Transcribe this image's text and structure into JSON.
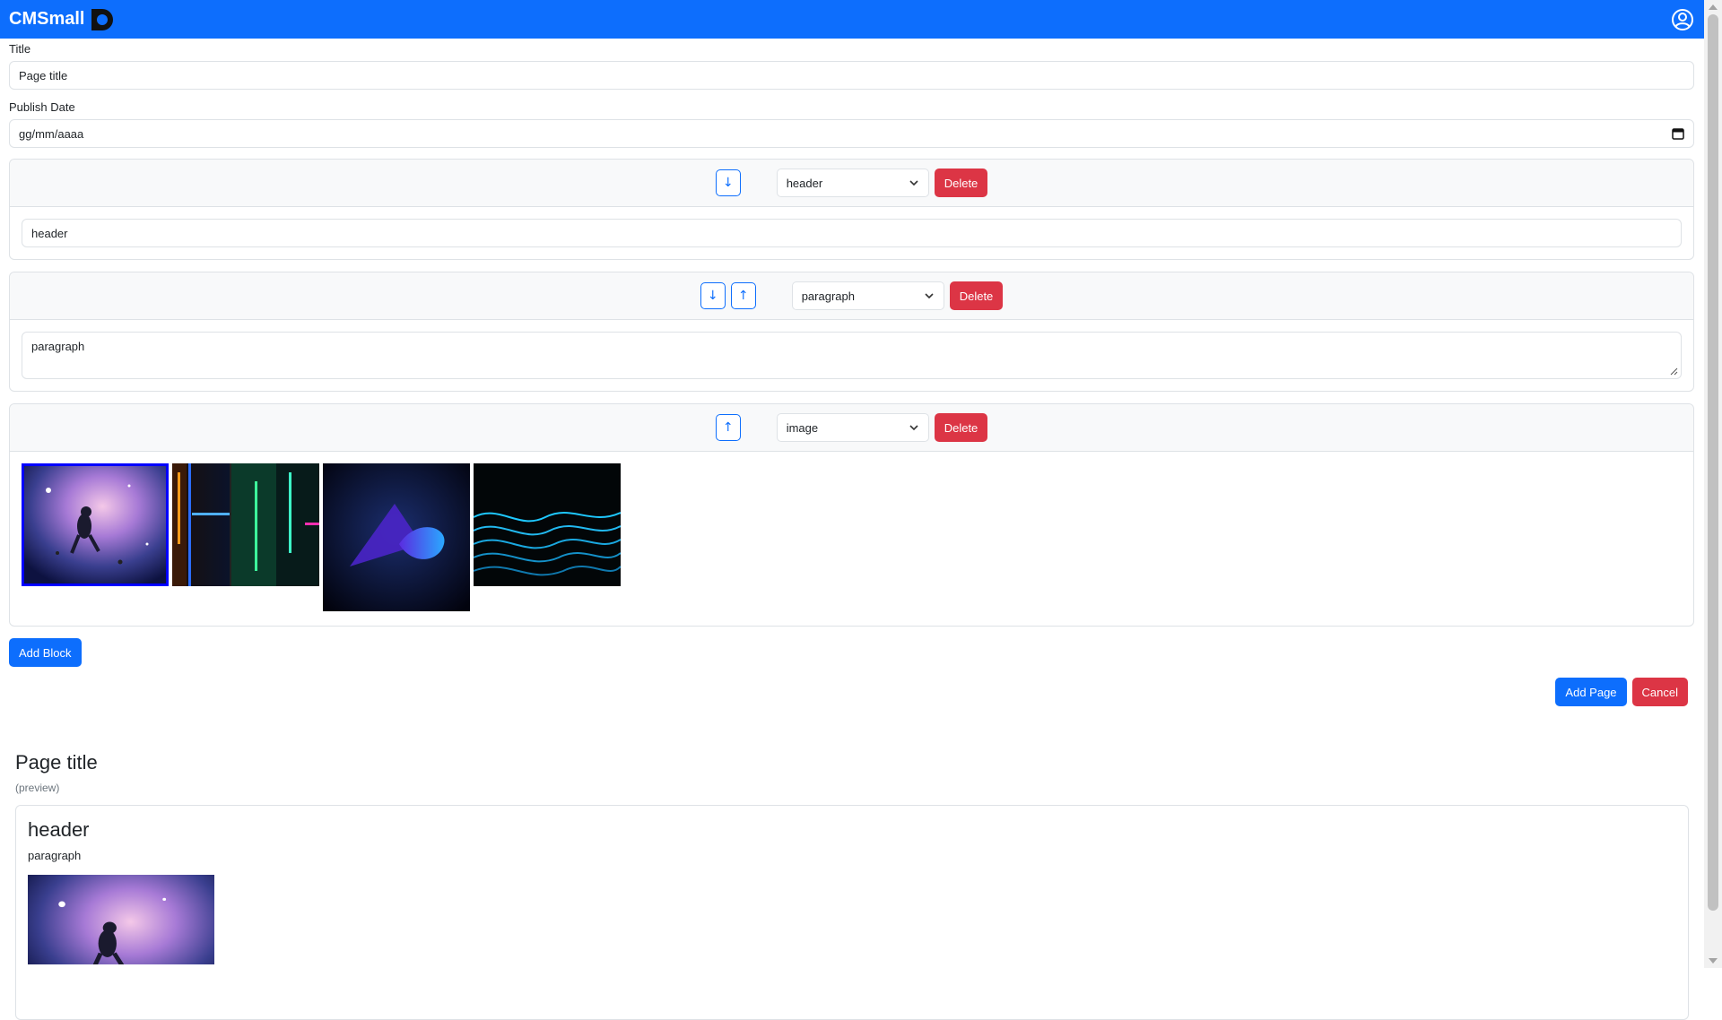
{
  "app": {
    "brand": "CMSmall"
  },
  "form": {
    "title_label": "Title",
    "title_value": "Page title",
    "date_label": "Publish Date",
    "date_value": "gg/mm/aaaa"
  },
  "blocks": [
    {
      "type_value": "header",
      "content": "header",
      "delete_label": "Delete",
      "down_arrow": "↓"
    },
    {
      "type_value": "paragraph",
      "content": "paragraph",
      "delete_label": "Delete",
      "down_arrow": "↓",
      "up_arrow": "↑"
    },
    {
      "type_value": "image",
      "delete_label": "Delete",
      "up_arrow": "↑",
      "images": [
        {
          "icon": "galaxy-astronaut-image",
          "selected": true
        },
        {
          "icon": "neon-lights-image",
          "selected": false
        },
        {
          "icon": "abstract-blue-shape-image",
          "selected": false
        },
        {
          "icon": "cyan-waves-image",
          "selected": false
        }
      ]
    }
  ],
  "buttons": {
    "add_block": "Add Block",
    "add_page": "Add Page",
    "cancel": "Cancel"
  },
  "preview": {
    "title": "Page title",
    "subtitle": "(preview)",
    "header": "header",
    "paragraph": "paragraph"
  },
  "colors": {
    "primary": "#0d6efd",
    "danger": "#dc3545",
    "selection": "#0000ff"
  }
}
